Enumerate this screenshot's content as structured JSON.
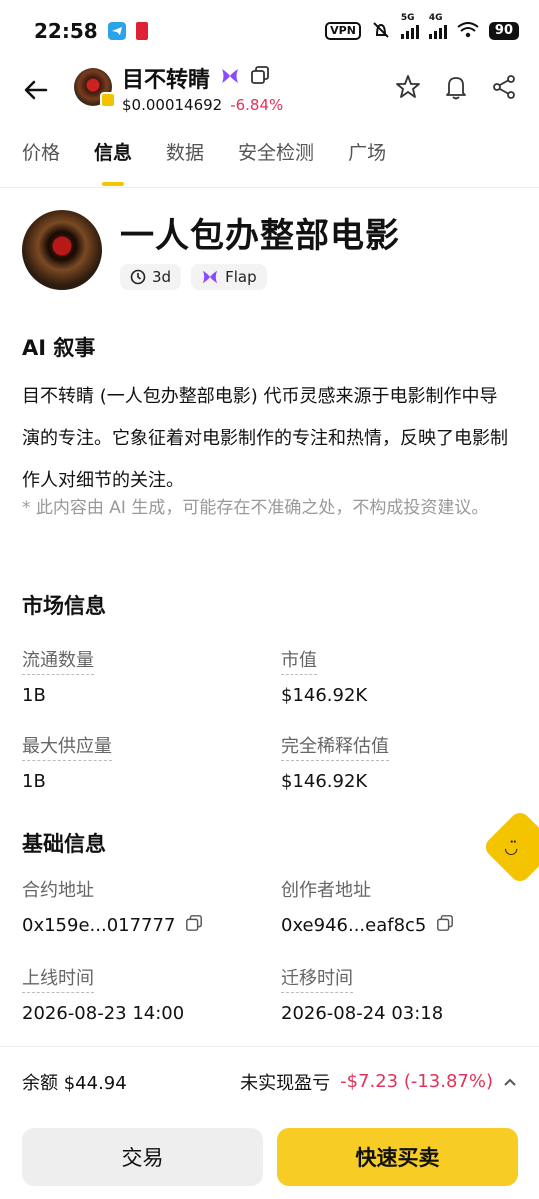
{
  "status_bar": {
    "time": "22:58",
    "vpn": "VPN",
    "net1": "5G",
    "net2": "4G",
    "battery": "90"
  },
  "header": {
    "token_name": "目不转睛",
    "price": "$0.00014692",
    "change": "-6.84%",
    "accent": "#e0325a"
  },
  "tabs": [
    "价格",
    "信息",
    "数据",
    "安全检测",
    "广场"
  ],
  "token": {
    "full_name": "一人包办整部电影",
    "age": "3d",
    "platform": "Flap"
  },
  "ai": {
    "title": "AI 叙事",
    "description": "目不转睛 (一人包办整部电影) 代币灵感来源于电影制作中导演的专注。它象征着对电影制作的专注和热情，反映了电影制作人对细节的关注。",
    "disclaimer": "* 此内容由 AI 生成，可能存在不准确之处，不构成投资建议。"
  },
  "market": {
    "title": "市场信息",
    "circulating_label": "流通数量",
    "circulating": "1B",
    "mcap_label": "市值",
    "mcap": "$146.92K",
    "max_supply_label": "最大供应量",
    "max_supply": "1B",
    "fdv_label": "完全稀释估值",
    "fdv": "$146.92K"
  },
  "basic": {
    "title": "基础信息",
    "contract_label": "合约地址",
    "contract": "0x159e...017777",
    "creator_label": "创作者地址",
    "creator": "0xe946...eaf8c5",
    "launch_label": "上线时间",
    "launch": "2026-08-23 14:00",
    "migrate_label": "迁移时间",
    "migrate": "2026-08-24 03:18"
  },
  "bottom": {
    "balance": "余额 $44.94",
    "unrealized_label": "未实现盈亏",
    "unrealized": "-$7.23 (-13.87%)",
    "trade": "交易",
    "quick": "快速买卖"
  }
}
